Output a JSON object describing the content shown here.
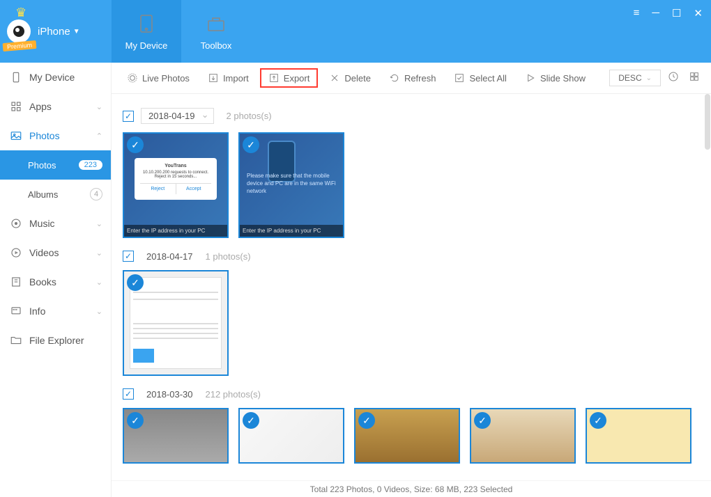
{
  "brand": {
    "device": "iPhone",
    "premium": "Premium"
  },
  "tabs": {
    "my_device": "My Device",
    "toolbox": "Toolbox"
  },
  "sidebar": {
    "my_device": "My Device",
    "apps": "Apps",
    "photos": "Photos",
    "photos_sub": "Photos",
    "photos_count": "223",
    "albums": "Albums",
    "albums_count": "4",
    "music": "Music",
    "videos": "Videos",
    "books": "Books",
    "info": "Info",
    "file_explorer": "File Explorer"
  },
  "toolbar": {
    "live_photos": "Live Photos",
    "import": "Import",
    "export": "Export",
    "delete": "Delete",
    "refresh": "Refresh",
    "select_all": "Select All",
    "slide_show": "Slide Show",
    "sort": "DESC"
  },
  "groups": [
    {
      "date": "2018-04-19",
      "count": "2 photos(s)",
      "has_dropdown": true
    },
    {
      "date": "2018-04-17",
      "count": "1 photos(s)",
      "has_dropdown": false
    },
    {
      "date": "2018-03-30",
      "count": "212 photos(s)",
      "has_dropdown": false
    }
  ],
  "thumb1": {
    "title": "YouTrans",
    "msg": "10.10.200.200 requests to connect.\nReject in 15 seconds...",
    "reject": "Reject",
    "accept": "Accept",
    "caption": "Enter the IP address in your PC"
  },
  "thumb2": {
    "info": "Please make sure that the mobile device and PC are in the same WiFi network",
    "caption": "Enter the IP address in your PC"
  },
  "status": "Total 223 Photos, 0 Videos, Size: 68 MB, 223 Selected"
}
